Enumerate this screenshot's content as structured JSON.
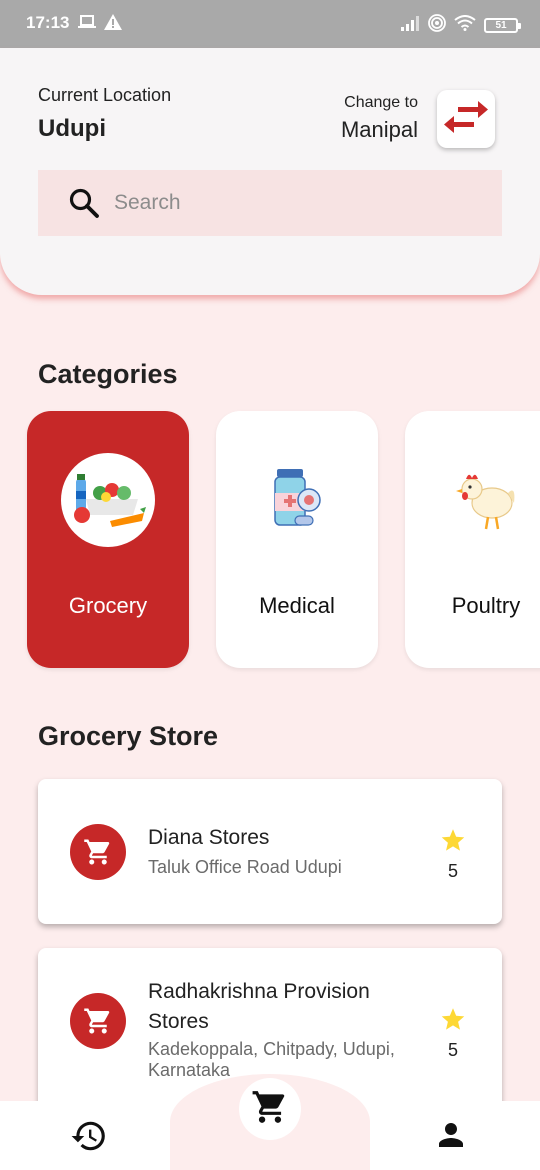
{
  "status_bar": {
    "time": "17:13",
    "battery": "51"
  },
  "header": {
    "current_location_label": "Current Location",
    "current_location": "Udupi",
    "change_to_label": "Change to",
    "change_to": "Manipal"
  },
  "search": {
    "placeholder": "Search"
  },
  "categories": {
    "title": "Categories",
    "items": [
      {
        "label": "Grocery",
        "icon": "grocery-icon",
        "selected": true
      },
      {
        "label": "Medical",
        "icon": "medicine-icon",
        "selected": false
      },
      {
        "label": "Poultry",
        "icon": "chicken-icon",
        "selected": false
      }
    ]
  },
  "stores": {
    "title": "Grocery Store",
    "items": [
      {
        "name": "Diana Stores",
        "address": "Taluk Office Road Udupi",
        "rating": "5"
      },
      {
        "name": "Radhakrishna Provision Stores",
        "address": "Kadekoppala, Chitpady, Udupi, Karnataka",
        "rating": "5"
      }
    ]
  },
  "bottom_nav": {
    "items": [
      {
        "icon": "history-icon"
      },
      {
        "icon": "cart-icon"
      },
      {
        "icon": "person-icon"
      }
    ]
  },
  "colors": {
    "accent": "#C62828",
    "background": "#FDEDED",
    "card": "#FFFFFF",
    "star": "#FDD835"
  }
}
